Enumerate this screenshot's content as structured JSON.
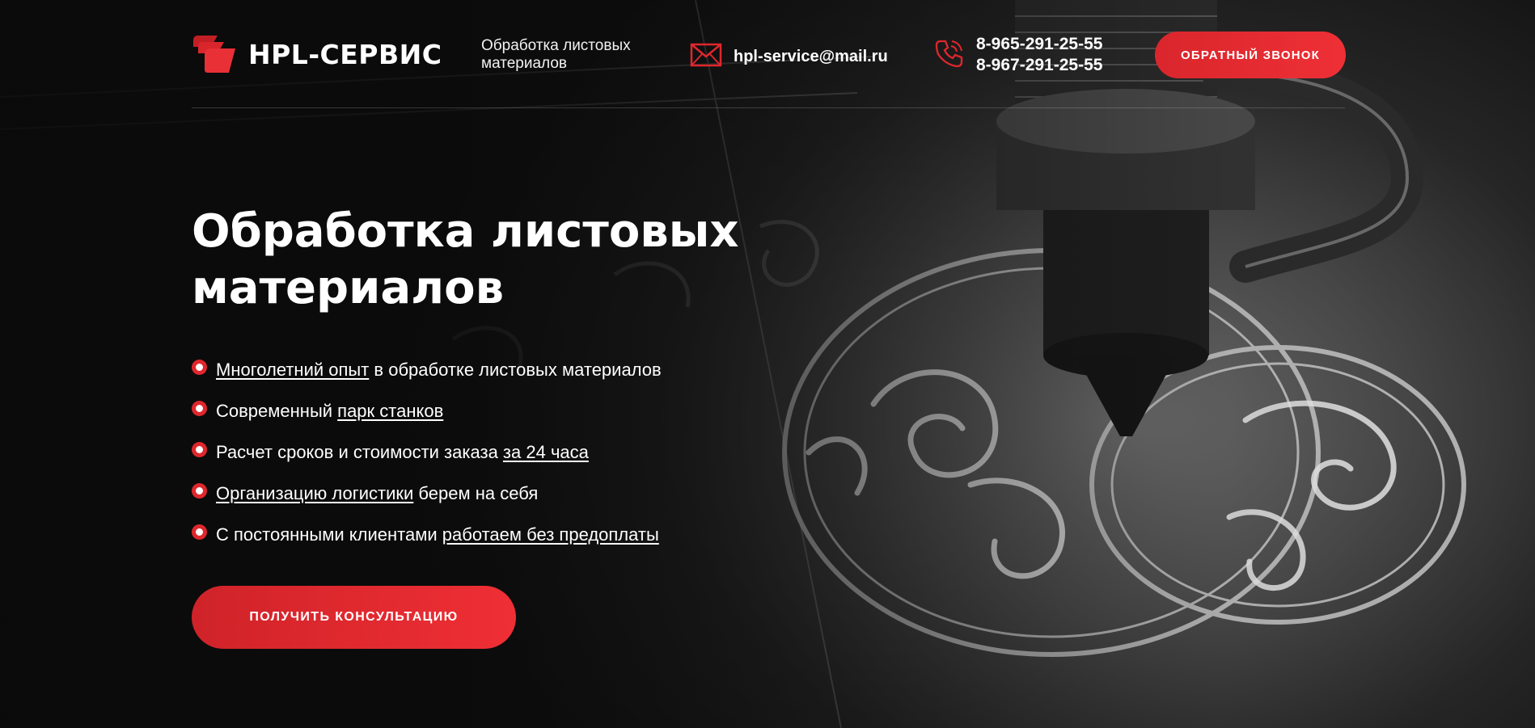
{
  "brand": {
    "name": "HPL-СЕРВИС",
    "accent_color": "#e0272d",
    "logo_icon": "stacked-sheets-logo-icon"
  },
  "header": {
    "tagline": "Обработка листовых материалов",
    "email": "hpl-service@mail.ru",
    "email_icon": "envelope-icon",
    "phone_icon": "phone-icon",
    "phones": [
      "8-965-291-25-55",
      "8-967-291-25-55"
    ],
    "callback_label": "ОБРАТНЫЙ ЗВОНОК"
  },
  "hero": {
    "title": "Обработка листовых материалов",
    "features": [
      {
        "link": "Многолетний опыт",
        "text": " в обработке листовых материалов"
      },
      {
        "text": "Современный ",
        "link": "парк станков"
      },
      {
        "text": "Расчет сроков и стоимости заказа ",
        "link": "за 24 часа"
      },
      {
        "link": "Организацию логистики",
        "text": " берем на себя"
      },
      {
        "text": "С постоянными клиентами ",
        "link": "работаем без предоплаты"
      }
    ],
    "cta_label": "ПОЛУЧИТЬ КОНСУЛЬТАЦИЮ"
  }
}
